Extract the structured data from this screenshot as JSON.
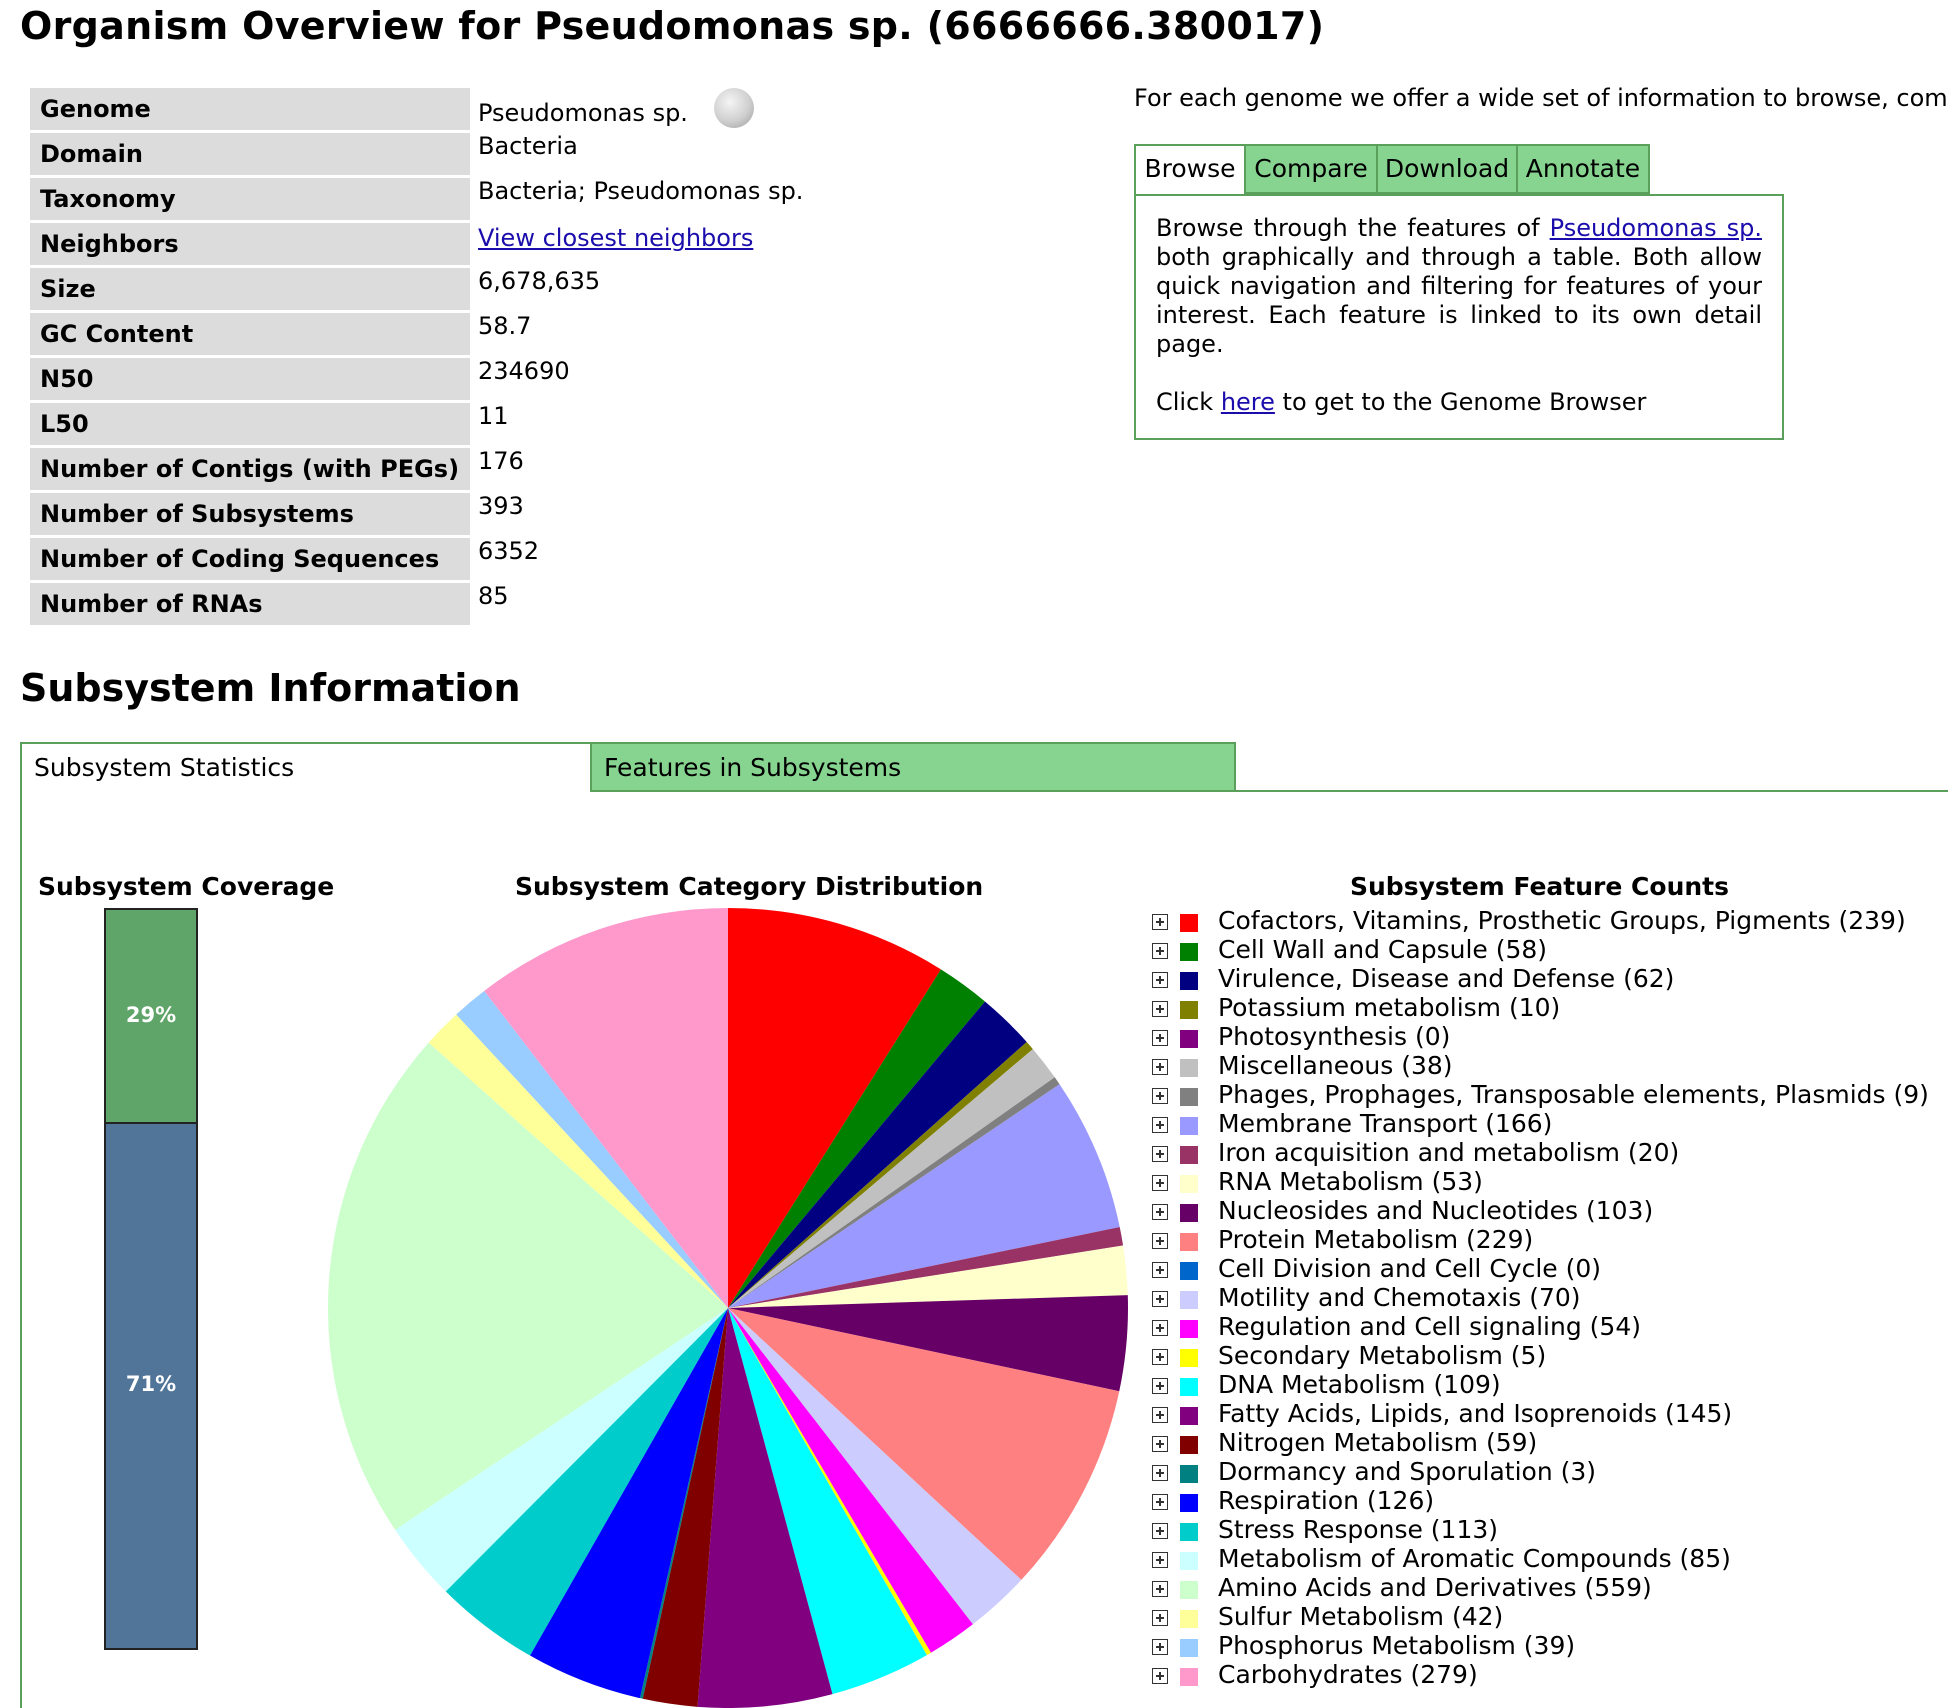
{
  "page_title": "Organism Overview for Pseudomonas sp. (6666666.380017)",
  "overview": [
    {
      "label": "Genome",
      "value": "Pseudomonas sp."
    },
    {
      "label": "Domain",
      "value": "Bacteria"
    },
    {
      "label": "Taxonomy",
      "value": "Bacteria; Pseudomonas sp."
    },
    {
      "label": "Neighbors",
      "value": "View closest neighbors",
      "link": true
    },
    {
      "label": "Size",
      "value": "6,678,635"
    },
    {
      "label": "GC Content",
      "value": "58.7"
    },
    {
      "label": "N50",
      "value": "234690"
    },
    {
      "label": "L50",
      "value": "11"
    },
    {
      "label": "Number of Contigs (with PEGs)",
      "value": "176"
    },
    {
      "label": "Number of Subsystems",
      "value": "393"
    },
    {
      "label": "Number of Coding Sequences",
      "value": "6352"
    },
    {
      "label": "Number of RNAs",
      "value": "85"
    }
  ],
  "info": {
    "intro": "For each genome we offer a wide set of information to browse, com",
    "tabs": [
      "Browse",
      "Compare",
      "Download",
      "Annotate"
    ],
    "active_tab": "Browse",
    "text_before_link": "Browse through the features of ",
    "organism_link": "Pseudomonas sp.",
    "text_after_link": " both graphically and through a table. Both allow quick navigation and filtering for features of your interest. Each feature is linked to its own detail page.",
    "click_prefix": "Click ",
    "here_link": "here",
    "click_suffix": " to get to the Genome Browser"
  },
  "subsystem": {
    "section_title": "Subsystem Information",
    "tabs": [
      "Subsystem Statistics",
      "Features in Subsystems"
    ],
    "active_tab": "Subsystem Statistics",
    "coverage_title": "Subsystem Coverage",
    "distribution_title": "Subsystem Category Distribution",
    "counts_title": "Subsystem Feature Counts"
  },
  "chart_data": [
    {
      "type": "bar",
      "title": "Subsystem Coverage",
      "stacked": true,
      "series": [
        {
          "label": "29%",
          "value": 29,
          "color": "#5fa468"
        },
        {
          "label": "71%",
          "value": 71,
          "color": "#517599"
        }
      ]
    },
    {
      "type": "pie",
      "title": "Subsystem Category Distribution",
      "categories": [
        {
          "name": "Cofactors, Vitamins, Prosthetic Groups, Pigments",
          "value": 239,
          "color": "#ff0000"
        },
        {
          "name": "Cell Wall and Capsule",
          "value": 58,
          "color": "#008000"
        },
        {
          "name": "Virulence, Disease and Defense",
          "value": 62,
          "color": "#000080"
        },
        {
          "name": "Potassium metabolism",
          "value": 10,
          "color": "#808000"
        },
        {
          "name": "Photosynthesis",
          "value": 0,
          "color": "#800080"
        },
        {
          "name": "Miscellaneous",
          "value": 38,
          "color": "#c0c0c0"
        },
        {
          "name": "Phages, Prophages, Transposable elements, Plasmids",
          "value": 9,
          "color": "#808080"
        },
        {
          "name": "Membrane Transport",
          "value": 166,
          "color": "#9999ff"
        },
        {
          "name": "Iron acquisition and metabolism",
          "value": 20,
          "color": "#993366"
        },
        {
          "name": "RNA Metabolism",
          "value": 53,
          "color": "#ffffcc"
        },
        {
          "name": "Nucleosides and Nucleotides",
          "value": 103,
          "color": "#660066"
        },
        {
          "name": "Protein Metabolism",
          "value": 229,
          "color": "#ff8080"
        },
        {
          "name": "Cell Division and Cell Cycle",
          "value": 0,
          "color": "#0066cc"
        },
        {
          "name": "Motility and Chemotaxis",
          "value": 70,
          "color": "#ccccff"
        },
        {
          "name": "Regulation and Cell signaling",
          "value": 54,
          "color": "#ff00ff"
        },
        {
          "name": "Secondary Metabolism",
          "value": 5,
          "color": "#ffff00"
        },
        {
          "name": "DNA Metabolism",
          "value": 109,
          "color": "#00ffff"
        },
        {
          "name": "Fatty Acids, Lipids, and Isoprenoids",
          "value": 145,
          "color": "#800080"
        },
        {
          "name": "Nitrogen Metabolism",
          "value": 59,
          "color": "#800000"
        },
        {
          "name": "Dormancy and Sporulation",
          "value": 3,
          "color": "#008080"
        },
        {
          "name": "Respiration",
          "value": 126,
          "color": "#0000ff"
        },
        {
          "name": "Stress Response",
          "value": 113,
          "color": "#00cccc"
        },
        {
          "name": "Metabolism of Aromatic Compounds",
          "value": 85,
          "color": "#ccffff"
        },
        {
          "name": "Amino Acids and Derivatives",
          "value": 559,
          "color": "#ccffcc"
        },
        {
          "name": "Sulfur Metabolism",
          "value": 42,
          "color": "#ffff99"
        },
        {
          "name": "Phosphorus Metabolism",
          "value": 39,
          "color": "#99ccff"
        },
        {
          "name": "Carbohydrates",
          "value": 279,
          "color": "#ff99cc"
        }
      ]
    }
  ],
  "legend_items": [
    "Cofactors, Vitamins, Prosthetic Groups, Pigments (239)",
    "Cell Wall and Capsule (58)",
    "Virulence, Disease and Defense (62)",
    "Potassium metabolism (10)",
    "Photosynthesis (0)",
    "Miscellaneous (38)",
    "Phages, Prophages, Transposable elements, Plasmids (9)",
    "Membrane Transport (166)",
    "Iron acquisition and metabolism (20)",
    "RNA Metabolism (53)",
    "Nucleosides and Nucleotides (103)",
    "Protein Metabolism (229)",
    "Cell Division and Cell Cycle (0)",
    "Motility and Chemotaxis (70)",
    "Regulation and Cell signaling (54)",
    "Secondary Metabolism (5)",
    "DNA Metabolism (109)",
    "Fatty Acids, Lipids, and Isoprenoids (145)",
    "Nitrogen Metabolism (59)",
    "Dormancy and Sporulation (3)",
    "Respiration (126)",
    "Stress Response (113)",
    "Metabolism of Aromatic Compounds (85)",
    "Amino Acids and Derivatives (559)",
    "Sulfur Metabolism (42)",
    "Phosphorus Metabolism (39)",
    "Carbohydrates (279)"
  ],
  "icons": {
    "genome_external_link": "wikipedia-globe-icon",
    "expand": "plus-box-icon"
  }
}
